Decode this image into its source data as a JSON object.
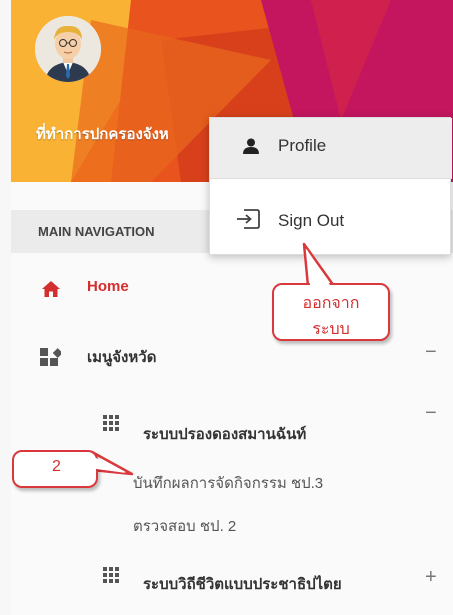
{
  "header": {
    "title": "ที่ทำการปกครองจังห"
  },
  "dropdown": {
    "profile_label": "Profile",
    "signout_label": "Sign Out"
  },
  "callouts": {
    "signout_note_line1": "ออกจาก",
    "signout_note_line2": "ระบบ",
    "step_number": "2"
  },
  "sidebar": {
    "nav_header": "MAIN NAVIGATION",
    "home_label": "Home",
    "province_menu_label": "เมนูจังหวัด",
    "province_menu_sign": "−",
    "reconcile_label": "ระบบปรองดองสมานฉันท์",
    "reconcile_sign": "−",
    "record_results_label": "บันทึกผลการจัดกิจกรรม ชป.3",
    "verify_label": "ตรวจสอบ ชป. 2",
    "democracy_label": "ระบบวิถีชีวิตแบบประชาธิปไตย",
    "democracy_sign": "+"
  },
  "colors": {
    "accent_red": "#d32f2f",
    "callout_border": "#d9393d",
    "header_orange": "#f47a1f",
    "header_magenta": "#c4155f"
  },
  "icons": {
    "home": "home-icon",
    "menu": "dashboard-icon",
    "grid": "apps-grid-icon",
    "user": "user-icon",
    "signout": "sign-out-icon"
  }
}
